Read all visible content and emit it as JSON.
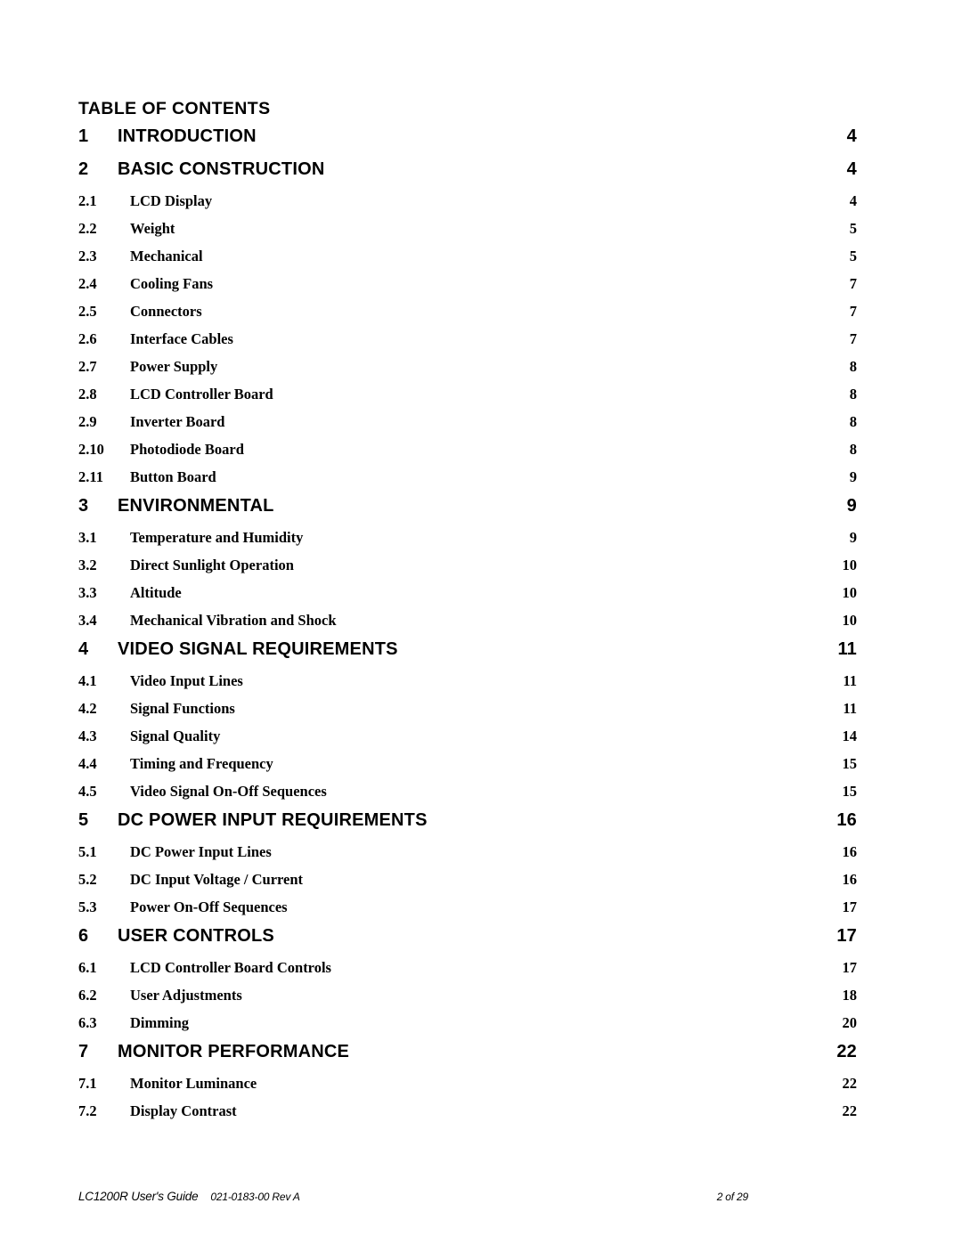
{
  "document": {
    "heading": "TABLE OF CONTENTS"
  },
  "toc": {
    "entries": [
      {
        "level": 1,
        "number": "1",
        "title": "INTRODUCTION",
        "page": "4"
      },
      {
        "level": 1,
        "number": "2",
        "title": "BASIC CONSTRUCTION",
        "page": "4"
      },
      {
        "level": 2,
        "number": "2.1",
        "title": "LCD Display",
        "page": "4"
      },
      {
        "level": 2,
        "number": "2.2",
        "title": "Weight",
        "page": "5"
      },
      {
        "level": 2,
        "number": "2.3",
        "title": "Mechanical",
        "page": "5"
      },
      {
        "level": 2,
        "number": "2.4",
        "title": "Cooling Fans",
        "page": "7"
      },
      {
        "level": 2,
        "number": "2.5",
        "title": "Connectors",
        "page": "7"
      },
      {
        "level": 2,
        "number": "2.6",
        "title": "Interface Cables",
        "page": "7"
      },
      {
        "level": 2,
        "number": "2.7",
        "title": "Power Supply",
        "page": "8"
      },
      {
        "level": 2,
        "number": "2.8",
        "title": "LCD Controller Board",
        "page": "8"
      },
      {
        "level": 2,
        "number": "2.9",
        "title": "Inverter Board",
        "page": "8"
      },
      {
        "level": 2,
        "number": "2.10",
        "title": "Photodiode Board",
        "page": "8"
      },
      {
        "level": 2,
        "number": "2.11",
        "title": "Button Board",
        "page": "9"
      },
      {
        "level": 1,
        "number": "3",
        "title": "ENVIRONMENTAL",
        "page": "9"
      },
      {
        "level": 2,
        "number": "3.1",
        "title": "Temperature and Humidity",
        "page": "9"
      },
      {
        "level": 2,
        "number": "3.2",
        "title": "Direct Sunlight Operation",
        "page": "10"
      },
      {
        "level": 2,
        "number": "3.3",
        "title": "Altitude",
        "page": "10"
      },
      {
        "level": 2,
        "number": "3.4",
        "title": "Mechanical Vibration and Shock",
        "page": "10"
      },
      {
        "level": 1,
        "number": "4",
        "title": "VIDEO SIGNAL REQUIREMENTS",
        "page": "11"
      },
      {
        "level": 2,
        "number": "4.1",
        "title": "Video Input Lines",
        "page": "11"
      },
      {
        "level": 2,
        "number": "4.2",
        "title": "Signal Functions",
        "page": "11"
      },
      {
        "level": 2,
        "number": "4.3",
        "title": "Signal Quality",
        "page": "14"
      },
      {
        "level": 2,
        "number": "4.4",
        "title": "Timing and Frequency",
        "page": "15"
      },
      {
        "level": 2,
        "number": "4.5",
        "title": "Video Signal On-Off Sequences",
        "page": "15"
      },
      {
        "level": 1,
        "number": "5",
        "title": "DC POWER INPUT REQUIREMENTS",
        "page": "16"
      },
      {
        "level": 2,
        "number": "5.1",
        "title": "DC Power Input Lines",
        "page": "16"
      },
      {
        "level": 2,
        "number": "5.2",
        "title": "DC Input Voltage / Current",
        "page": "16"
      },
      {
        "level": 2,
        "number": "5.3",
        "title": "Power On-Off Sequences",
        "page": "17"
      },
      {
        "level": 1,
        "number": "6",
        "title": "USER CONTROLS",
        "page": "17"
      },
      {
        "level": 2,
        "number": "6.1",
        "title": "LCD Controller Board Controls",
        "page": "17"
      },
      {
        "level": 2,
        "number": "6.2",
        "title": "User Adjustments",
        "page": "18"
      },
      {
        "level": 2,
        "number": "6.3",
        "title": "Dimming",
        "page": "20"
      },
      {
        "level": 1,
        "number": "7",
        "title": "MONITOR PERFORMANCE",
        "page": "22"
      },
      {
        "level": 2,
        "number": "7.1",
        "title": "Monitor Luminance",
        "page": "22"
      },
      {
        "level": 2,
        "number": "7.2",
        "title": "Display Contrast",
        "page": "22"
      }
    ]
  },
  "footer": {
    "document_title": "LC1200R User's Guide",
    "part_number": "021-0183-00 Rev A",
    "page_indicator": "2 of 29"
  }
}
